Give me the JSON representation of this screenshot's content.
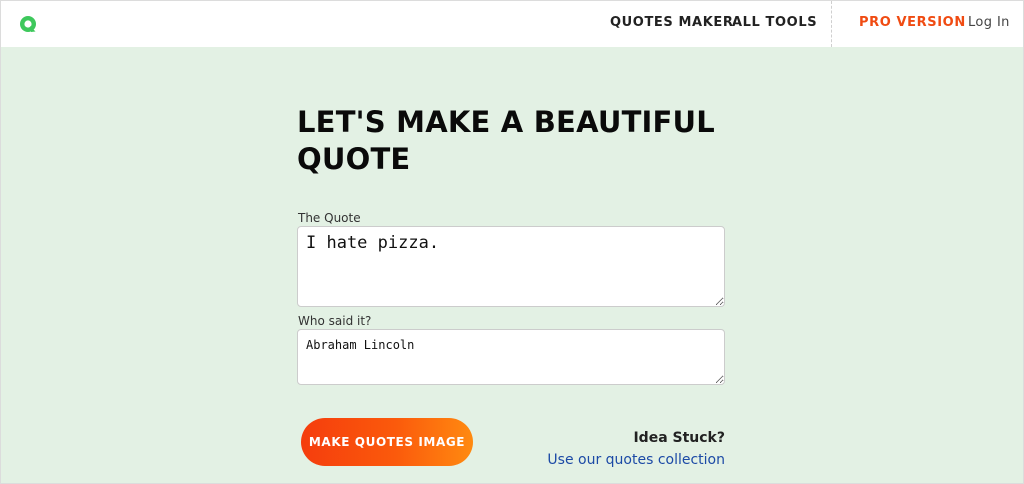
{
  "header": {
    "nav": {
      "quotes_maker": "QUOTES MAKER",
      "all_tools": "ALL TOOLS",
      "pro_version": "PRO VERSION",
      "login": "Log In"
    }
  },
  "main": {
    "title": "LET'S MAKE A BEAUTIFUL QUOTE",
    "quote_label": "The Quote",
    "quote_value": "I hate pizza.",
    "author_label": "Who said it?",
    "author_value": "Abraham Lincoln",
    "cta_label": "MAKE QUOTES IMAGE",
    "idea_title": "Idea Stuck?",
    "idea_link": "Use our quotes collection"
  },
  "colors": {
    "background": "#e3f1e4",
    "accent": "#f04b12",
    "logo": "#3ec85c",
    "link": "#1c4aa6"
  }
}
